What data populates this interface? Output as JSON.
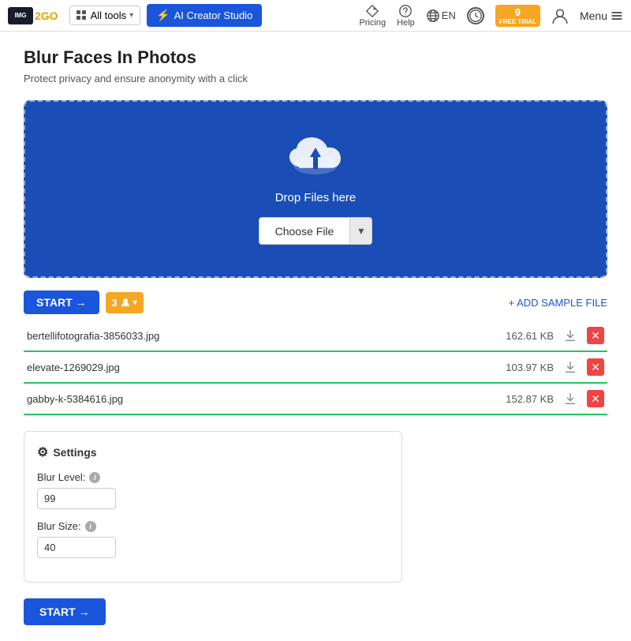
{
  "header": {
    "logo_text": "IMG",
    "logo_go": "2GO",
    "all_tools_label": "All tools",
    "ai_creator_label": "AI Creator Studio",
    "pricing_label": "Pricing",
    "help_label": "Help",
    "lang_label": "EN",
    "trial_count": "9",
    "trial_label": "FREE TRIAL",
    "menu_label": "Menu"
  },
  "page": {
    "title": "Blur Faces In Photos",
    "subtitle": "Protect privacy and ensure anonymity with a click"
  },
  "dropzone": {
    "label": "Drop Files here",
    "choose_file_label": "Choose File",
    "choose_file_dropdown": "▾"
  },
  "toolbar": {
    "start_label": "START →",
    "count": "3",
    "add_sample_label": "+ ADD SAMPLE FILE"
  },
  "files": [
    {
      "name": "bertellifotografia-3856033.jpg",
      "size": "162.61 KB"
    },
    {
      "name": "elevate-1269029.jpg",
      "size": "103.97 KB"
    },
    {
      "name": "gabby-k-5384616.jpg",
      "size": "152.87 KB"
    }
  ],
  "settings": {
    "header": "Settings",
    "blur_level_label": "Blur Level:",
    "blur_level_value": "99",
    "blur_size_label": "Blur Size:",
    "blur_size_value": "40",
    "start_label": "START →"
  }
}
